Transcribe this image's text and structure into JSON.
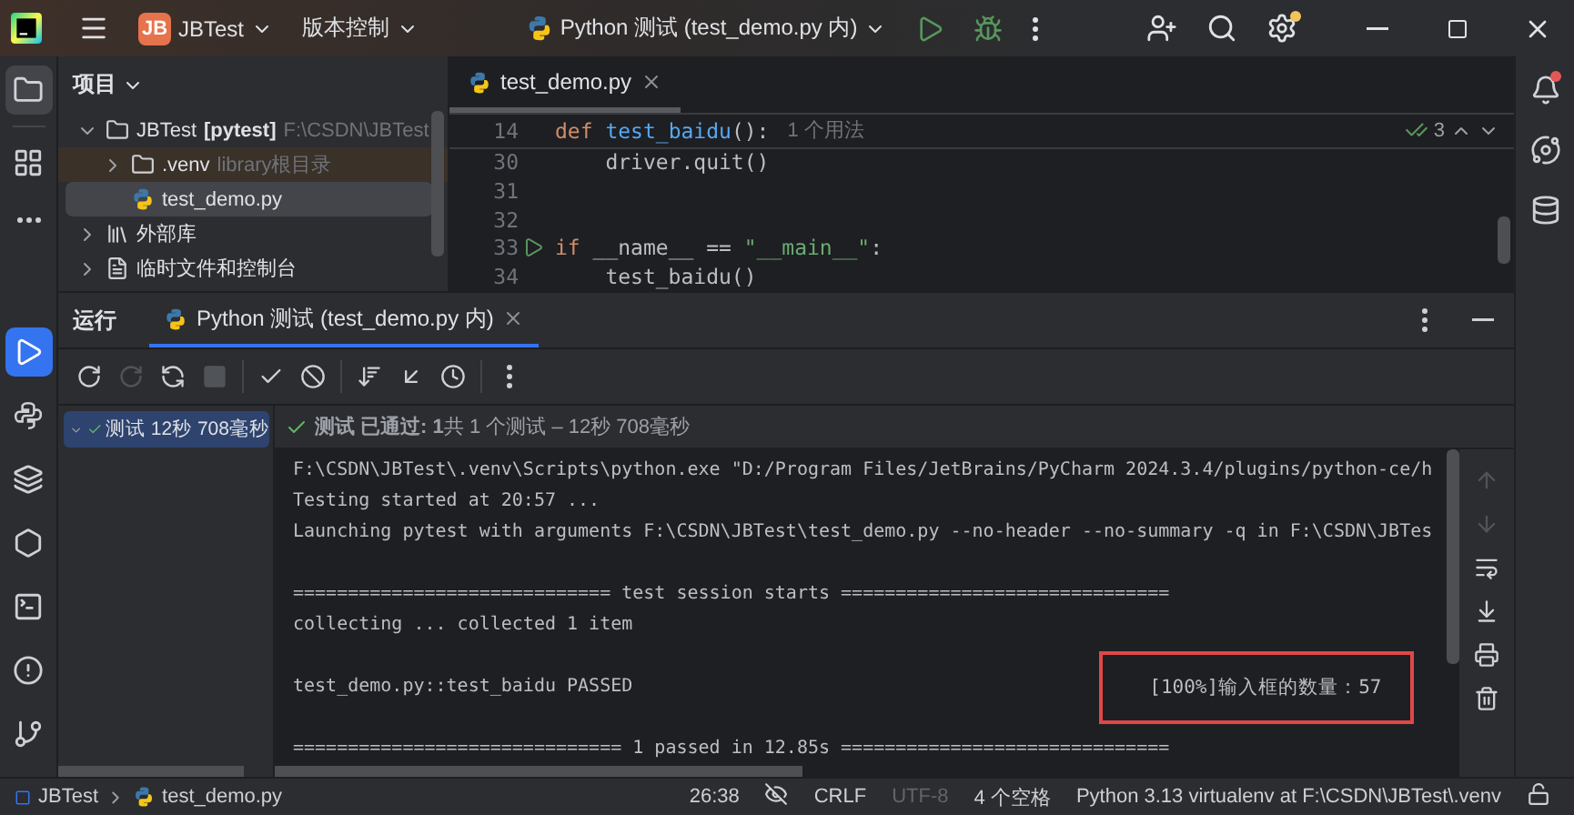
{
  "titlebar": {
    "project_badge": "JB",
    "project": "JBTest",
    "vcs": "版本控制",
    "run_config": "Python 测试 (test_demo.py 内)",
    "settings_badge": true
  },
  "left_toolbar": {
    "top": [
      {
        "kind": "folder",
        "selected": true
      },
      {
        "kind": "structure",
        "selected": false
      },
      {
        "kind": "more",
        "selected": false
      }
    ],
    "bottom": [
      {
        "kind": "run",
        "selected": true
      },
      {
        "kind": "python",
        "selected": false
      },
      {
        "kind": "layers",
        "selected": false
      },
      {
        "kind": "services",
        "selected": false
      },
      {
        "kind": "terminal",
        "selected": false
      },
      {
        "kind": "problems",
        "selected": false
      },
      {
        "kind": "git",
        "selected": false
      }
    ]
  },
  "project_panel": {
    "title": "项目",
    "tree": [
      {
        "kind": "folder",
        "label": "JBTest",
        "tag": "[pytest]",
        "note": "F:\\CSDN\\JBTest",
        "expanded": true,
        "selected": false,
        "highlighted": false,
        "children": [
          {
            "kind": "folder",
            "label": ".venv",
            "note": "library根目录",
            "expanded": false,
            "selected": false,
            "highlighted": true
          },
          {
            "kind": "python",
            "label": "test_demo.py",
            "selected": true,
            "highlighted": false
          }
        ]
      },
      {
        "kind": "library",
        "label": "外部库",
        "expanded": false,
        "selected": false,
        "highlighted": false
      },
      {
        "kind": "scratch",
        "label": "临时文件和控制台",
        "expanded": false,
        "selected": false,
        "highlighted": false
      }
    ]
  },
  "editor": {
    "tab": {
      "label": "test_demo.py",
      "selected": true
    },
    "sticky": {
      "number": "14",
      "tokens": [
        {
          "kind": "keyword",
          "text": "def "
        },
        {
          "kind": "function",
          "text": "test_baidu"
        },
        {
          "kind": "plain",
          "text": "():"
        }
      ],
      "hint": "1 个用法"
    },
    "inspections": "3",
    "lines": [
      {
        "number": "30",
        "runnable": false,
        "tokens": [
          {
            "kind": "plain",
            "text": "    driver.quit()"
          }
        ]
      },
      {
        "number": "31",
        "runnable": false
      },
      {
        "number": "32",
        "runnable": false
      },
      {
        "number": "33",
        "runnable": true,
        "tokens": [
          {
            "kind": "keyword",
            "text": "if "
          },
          {
            "kind": "plain",
            "text": "__name__ == "
          },
          {
            "kind": "string",
            "text": "\"__main__\""
          },
          {
            "kind": "plain",
            "text": ":"
          }
        ]
      },
      {
        "number": "34",
        "runnable": false,
        "tokens": [
          {
            "kind": "plain",
            "text": "    test_baidu()"
          }
        ]
      }
    ]
  },
  "run_panel": {
    "title": "运行",
    "tabs": [
      {
        "label": "Python 测试 (test_demo.py 内)",
        "selected": true
      }
    ],
    "toolbar": [
      {
        "kind": "rerun",
        "disabled": false
      },
      {
        "kind": "rerun-failed",
        "disabled": true
      },
      {
        "kind": "auto-test",
        "disabled": false
      },
      {
        "kind": "stop",
        "disabled": true
      },
      {
        "kind": "separator"
      },
      {
        "kind": "show-passed",
        "disabled": false
      },
      {
        "kind": "show-ignored",
        "disabled": false
      },
      {
        "kind": "separator"
      },
      {
        "kind": "sort",
        "disabled": false
      },
      {
        "kind": "import",
        "disabled": false
      },
      {
        "kind": "history",
        "disabled": false
      },
      {
        "kind": "separator"
      },
      {
        "kind": "more",
        "disabled": false
      }
    ],
    "tree": [
      {
        "label": "测试 12秒 708毫秒",
        "passed": true,
        "expanded": true,
        "selected": true
      }
    ],
    "summary": {
      "passed": true,
      "text": "**测试 已通过: 1**共 1 个测试 – 12秒 708毫秒"
    },
    "console": [
      [
        {
          "text": "F:\\CSDN\\JBTest\\.venv\\Scripts\\python.exe \"D:/Program Files/JetBrains/PyCharm 2024.3.4/plugins/python-ce/h"
        },
        {
          "text": "Testing started at 20:57 ..."
        },
        {
          "text": "Launching pytest with arguments F:\\CSDN\\JBTest\\test_demo.py --no-header --no-summary -q in F:\\CSDN\\JBTes"
        }
      ],
      [
        {
          "text": "============================= test session starts =============================="
        },
        {
          "text": "collecting ... collected 1 item"
        }
      ],
      [
        {
          "text": "test_demo.py::test_baidu PASSED",
          "note": "[100%]输入框的数量：57",
          "highlighted": true
        }
      ],
      [
        {
          "text": "============================== 1 passed in 12.85s =============================="
        }
      ]
    ],
    "console_toolbar": [
      {
        "kind": "up",
        "disabled": true
      },
      {
        "kind": "down",
        "disabled": true
      },
      {
        "kind": "wrap",
        "disabled": false
      },
      {
        "kind": "scroll-end",
        "disabled": false
      },
      {
        "kind": "print",
        "disabled": false
      },
      {
        "kind": "clear",
        "disabled": false
      }
    ]
  },
  "right_toolbar": [
    {
      "kind": "notifications",
      "badge": true
    },
    {
      "kind": "assistant",
      "badge": false
    },
    {
      "kind": "database",
      "badge": false
    }
  ],
  "status_bar": {
    "breadcrumbs": [
      {
        "kind": "module",
        "label": "JBTest"
      },
      {
        "kind": "python",
        "label": "test_demo.py"
      }
    ],
    "items": [
      {
        "kind": "text",
        "text": "26:38",
        "disabled": false
      },
      {
        "kind": "inspection-icon"
      },
      {
        "kind": "text",
        "text": "CRLF",
        "disabled": false
      },
      {
        "kind": "text",
        "text": "UTF-8",
        "disabled": true
      },
      {
        "kind": "text",
        "text": "4 个空格",
        "disabled": false
      },
      {
        "kind": "text",
        "text": "Python 3.13 virtualenv at F:\\CSDN\\JBTest\\.venv",
        "disabled": false
      },
      {
        "kind": "lock-icon"
      }
    ]
  }
}
